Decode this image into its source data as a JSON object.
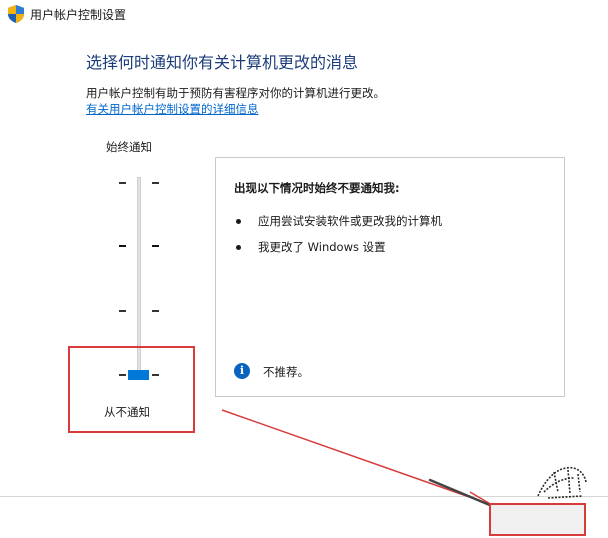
{
  "window": {
    "title": "用户帐户控制设置"
  },
  "main": {
    "heading": "选择何时通知你有关计算机更改的消息",
    "description": "用户帐户控制有助于预防有害程序对你的计算机进行更改。",
    "more_link": "有关用户帐户控制设置的详细信息"
  },
  "slider": {
    "top_label": "始终通知",
    "bottom_label": "从不通知",
    "levels": 4,
    "selected_level": 1
  },
  "info_panel": {
    "heading": "出现以下情况时始终不要通知我:",
    "bullets": [
      "应用尝试安装软件或更改我的计算机",
      "我更改了 Windows 设置"
    ],
    "note": "不推荐。"
  },
  "colors": {
    "accent": "#0078d7",
    "highlight": "#d93a3a",
    "heading": "#1c3d7a",
    "link": "#0066cc"
  },
  "icons": {
    "title": "uac-shield-icon",
    "note": "info-icon"
  }
}
